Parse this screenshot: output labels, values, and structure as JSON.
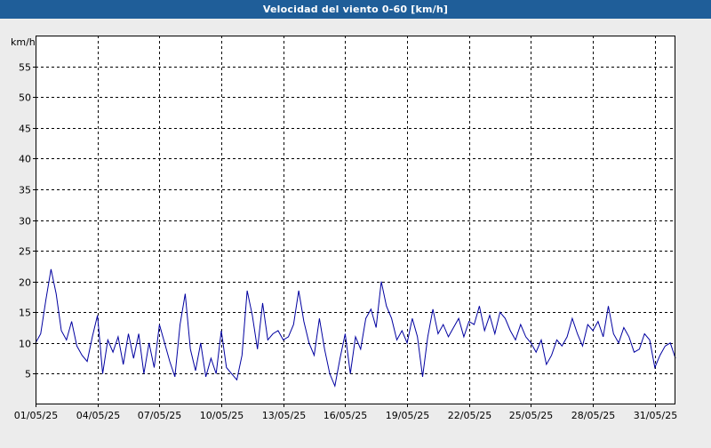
{
  "window": {
    "title": "Velocidad del viento 0-60 [km/h]"
  },
  "colors": {
    "titlebar": "#1f5e99",
    "background": "#ececec",
    "plot_background": "#ffffff",
    "series_line": "#0000a0",
    "grid": "#000000"
  },
  "chart_data": {
    "type": "line",
    "title": "Velocidad del viento 0-60 [km/h]",
    "ylabel": "km/h",
    "xlabel": "",
    "ylim": [
      0,
      60
    ],
    "xlim": [
      "2025-05-01",
      "2025-06-01"
    ],
    "grid": true,
    "legend": "none",
    "y_ticks": [
      5,
      10,
      15,
      20,
      25,
      30,
      35,
      40,
      45,
      50,
      55
    ],
    "x_ticks": [
      {
        "date": "2025-05-01",
        "label": "01/05/25"
      },
      {
        "date": "2025-05-04",
        "label": "04/05/25"
      },
      {
        "date": "2025-05-07",
        "label": "07/05/25"
      },
      {
        "date": "2025-05-10",
        "label": "10/05/25"
      },
      {
        "date": "2025-05-13",
        "label": "13/05/25"
      },
      {
        "date": "2025-05-16",
        "label": "16/05/25"
      },
      {
        "date": "2025-05-19",
        "label": "19/05/25"
      },
      {
        "date": "2025-05-22",
        "label": "22/05/25"
      },
      {
        "date": "2025-05-25",
        "label": "25/05/25"
      },
      {
        "date": "2025-05-28",
        "label": "28/05/25"
      },
      {
        "date": "2025-05-31",
        "label": "31/05/25"
      }
    ],
    "series": [
      {
        "x": [
          "2025-05-01 00:00",
          "2025-05-01 06:00",
          "2025-05-01 12:00",
          "2025-05-01 18:00",
          "2025-05-02 00:00",
          "2025-05-02 06:00",
          "2025-05-02 12:00",
          "2025-05-02 18:00",
          "2025-05-03 00:00",
          "2025-05-03 06:00",
          "2025-05-03 12:00",
          "2025-05-03 18:00",
          "2025-05-04 00:00",
          "2025-05-04 06:00",
          "2025-05-04 12:00",
          "2025-05-04 18:00",
          "2025-05-05 00:00",
          "2025-05-05 06:00",
          "2025-05-05 12:00",
          "2025-05-05 18:00",
          "2025-05-06 00:00",
          "2025-05-06 06:00",
          "2025-05-06 12:00",
          "2025-05-06 18:00",
          "2025-05-07 00:00",
          "2025-05-07 06:00",
          "2025-05-07 12:00",
          "2025-05-07 18:00",
          "2025-05-08 00:00",
          "2025-05-08 06:00",
          "2025-05-08 12:00",
          "2025-05-08 18:00",
          "2025-05-09 00:00",
          "2025-05-09 06:00",
          "2025-05-09 12:00",
          "2025-05-09 18:00",
          "2025-05-10 00:00",
          "2025-05-10 06:00",
          "2025-05-10 12:00",
          "2025-05-10 18:00",
          "2025-05-11 00:00",
          "2025-05-11 06:00",
          "2025-05-11 12:00",
          "2025-05-11 18:00",
          "2025-05-12 00:00",
          "2025-05-12 06:00",
          "2025-05-12 12:00",
          "2025-05-12 18:00",
          "2025-05-13 00:00",
          "2025-05-13 06:00",
          "2025-05-13 12:00",
          "2025-05-13 18:00",
          "2025-05-14 00:00",
          "2025-05-14 06:00",
          "2025-05-14 12:00",
          "2025-05-14 18:00",
          "2025-05-15 00:00",
          "2025-05-15 06:00",
          "2025-05-15 12:00",
          "2025-05-15 18:00",
          "2025-05-16 00:00",
          "2025-05-16 06:00",
          "2025-05-16 12:00",
          "2025-05-16 18:00",
          "2025-05-17 00:00",
          "2025-05-17 06:00",
          "2025-05-17 12:00",
          "2025-05-17 18:00",
          "2025-05-18 00:00",
          "2025-05-18 06:00",
          "2025-05-18 12:00",
          "2025-05-18 18:00",
          "2025-05-19 00:00",
          "2025-05-19 06:00",
          "2025-05-19 12:00",
          "2025-05-19 18:00",
          "2025-05-20 00:00",
          "2025-05-20 06:00",
          "2025-05-20 12:00",
          "2025-05-20 18:00",
          "2025-05-21 00:00",
          "2025-05-21 06:00",
          "2025-05-21 12:00",
          "2025-05-21 18:00",
          "2025-05-22 00:00",
          "2025-05-22 06:00",
          "2025-05-22 12:00",
          "2025-05-22 18:00",
          "2025-05-23 00:00",
          "2025-05-23 06:00",
          "2025-05-23 12:00",
          "2025-05-23 18:00",
          "2025-05-24 00:00",
          "2025-05-24 06:00",
          "2025-05-24 12:00",
          "2025-05-24 18:00",
          "2025-05-25 00:00",
          "2025-05-25 06:00",
          "2025-05-25 12:00",
          "2025-05-25 18:00",
          "2025-05-26 00:00",
          "2025-05-26 06:00",
          "2025-05-26 12:00",
          "2025-05-26 18:00",
          "2025-05-27 00:00",
          "2025-05-27 06:00",
          "2025-05-27 12:00",
          "2025-05-27 18:00",
          "2025-05-28 00:00",
          "2025-05-28 06:00",
          "2025-05-28 12:00",
          "2025-05-28 18:00",
          "2025-05-29 00:00",
          "2025-05-29 06:00",
          "2025-05-29 12:00",
          "2025-05-29 18:00",
          "2025-05-30 00:00",
          "2025-05-30 06:00",
          "2025-05-30 12:00",
          "2025-05-30 18:00",
          "2025-05-31 00:00",
          "2025-05-31 06:00",
          "2025-05-31 12:00",
          "2025-05-31 18:00",
          "2025-06-01 00:00"
        ],
        "values": [
          10.0,
          11.5,
          17.0,
          22.0,
          18.0,
          12.0,
          10.5,
          13.5,
          9.5,
          8.0,
          7.0,
          11.0,
          14.5,
          5.0,
          10.5,
          8.5,
          11.0,
          6.5,
          11.5,
          7.5,
          11.5,
          5.0,
          10.0,
          6.0,
          13.0,
          10.0,
          7.0,
          4.5,
          13.0,
          18.0,
          9.0,
          5.5,
          10.0,
          4.5,
          7.5,
          5.0,
          12.0,
          6.0,
          5.0,
          4.0,
          8.0,
          18.5,
          14.5,
          9.0,
          16.5,
          10.5,
          11.5,
          12.0,
          10.5,
          11.0,
          13.0,
          18.5,
          13.5,
          10.0,
          8.0,
          14.0,
          9.0,
          5.0,
          3.0,
          7.5,
          11.5,
          5.0,
          11.0,
          9.0,
          14.0,
          15.5,
          12.5,
          20.0,
          16.0,
          14.0,
          10.5,
          12.0,
          10.0,
          14.0,
          11.0,
          4.5,
          11.0,
          15.5,
          11.5,
          13.0,
          11.0,
          12.5,
          14.0,
          11.0,
          13.5,
          13.0,
          16.0,
          12.0,
          14.5,
          11.5,
          15.0,
          14.0,
          12.0,
          10.5,
          13.0,
          11.0,
          10.0,
          8.5,
          10.5,
          6.5,
          8.0,
          10.5,
          9.5,
          11.0,
          14.0,
          11.5,
          9.5,
          13.0,
          12.0,
          13.5,
          11.0,
          16.0,
          11.5,
          10.0,
          12.5,
          11.0,
          8.5,
          9.0,
          11.5,
          10.5,
          6.0,
          8.0,
          9.5,
          10.0,
          7.5
        ]
      }
    ]
  }
}
